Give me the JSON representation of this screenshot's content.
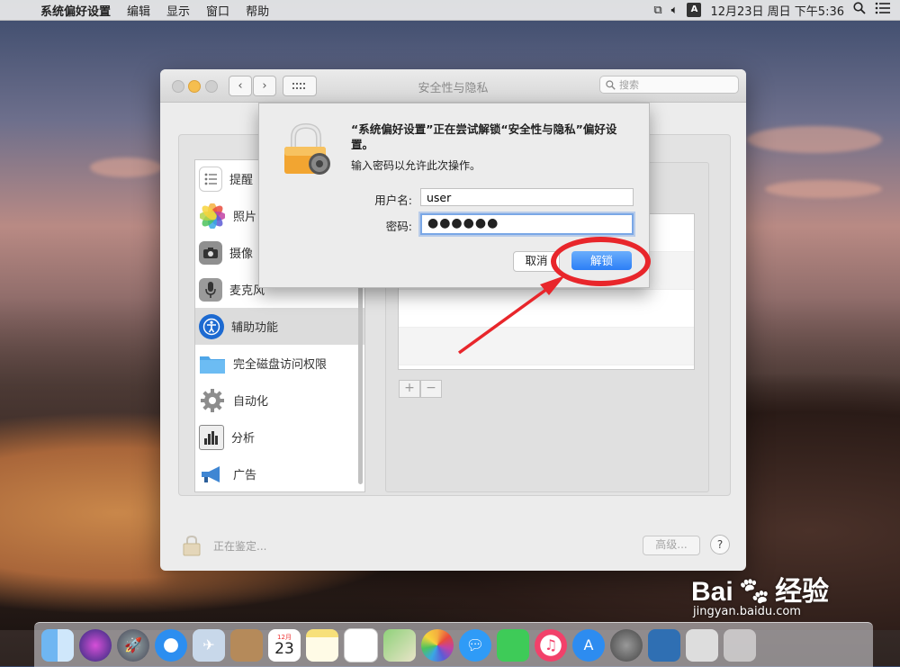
{
  "menubar": {
    "app_name": "系统偏好设置",
    "items": [
      "编辑",
      "显示",
      "窗口",
      "帮助"
    ],
    "input_source": "A",
    "clock": "12月23日 周日 下午5:36"
  },
  "window": {
    "title": "安全性与隐私",
    "search_placeholder": "搜索",
    "sidebar_items": [
      {
        "label": "提醒",
        "icon": "reminders-icon"
      },
      {
        "label": "照片",
        "icon": "photos-icon"
      },
      {
        "label": "摄像",
        "icon": "camera-icon"
      },
      {
        "label": "麦克风",
        "icon": "microphone-icon"
      },
      {
        "label": "辅助功能",
        "icon": "accessibility-icon",
        "selected": true
      },
      {
        "label": "完全磁盘访问权限",
        "icon": "folder-icon"
      },
      {
        "label": "自动化",
        "icon": "gear-icon"
      },
      {
        "label": "分析",
        "icon": "analytics-icon"
      },
      {
        "label": "广告",
        "icon": "megaphone-icon"
      }
    ],
    "add_button": "+",
    "remove_button": "−",
    "auth_status": "正在鉴定...",
    "advanced_button": "高级...",
    "help_button": "?"
  },
  "sheet": {
    "headline": "“系统偏好设置”正在尝试解锁“安全性与隐私”偏好设置。",
    "subline": "输入密码以允许此次操作。",
    "username_label": "用户名:",
    "username_value": "user",
    "password_label": "密码:",
    "password_value": "●●●●●●",
    "cancel_button": "取消",
    "unlock_button": "解锁"
  },
  "colors": {
    "accent_button": "#2b7ef6",
    "annotation_red": "#e8262b",
    "traffic_light_yellow": "#f5be4f"
  },
  "dock": {
    "calendar_day": "23",
    "calendar_month": "12月",
    "icons": [
      "finder-icon",
      "siri-icon",
      "launchpad-icon",
      "safari-icon",
      "mail-icon",
      "contacts-icon",
      "calendar-icon",
      "notes-icon",
      "reminders-icon",
      "maps-icon",
      "photos-icon",
      "messages-icon",
      "facetime-icon",
      "music-icon",
      "app-store-icon",
      "system-preferences-icon",
      "remote-desktop-icon",
      "printer-icon",
      "trash-icon"
    ]
  },
  "watermark": {
    "brand": "Bai",
    "brand_suffix": "经验",
    "url": "jingyan.baidu.com"
  }
}
